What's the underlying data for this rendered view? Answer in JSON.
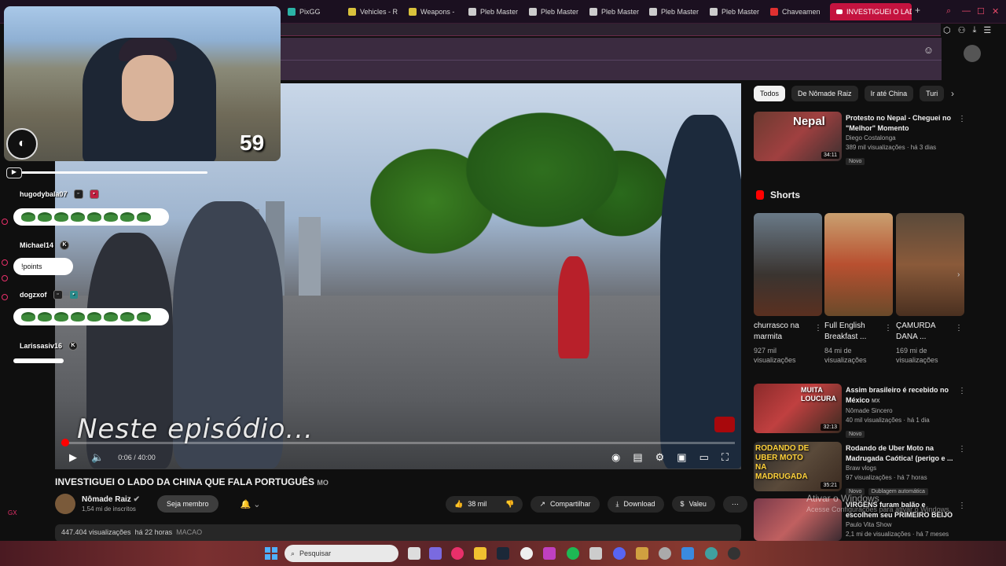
{
  "browser": {
    "tabs": [
      {
        "label": "PixGG",
        "color": "#2bb3a6"
      },
      {
        "label": "Vehicles - R",
        "color": "#d9c23c"
      },
      {
        "label": "Weapons -",
        "color": "#d9c23c"
      },
      {
        "label": "Pleb Master",
        "color": "#cccccc"
      },
      {
        "label": "Pleb Master",
        "color": "#cccccc"
      },
      {
        "label": "Pleb Master",
        "color": "#cccccc"
      },
      {
        "label": "Pleb Master",
        "color": "#cccccc"
      },
      {
        "label": "Pleb Master",
        "color": "#cccccc"
      },
      {
        "label": "Chaveamen",
        "color": "#e03030"
      }
    ],
    "active_tab": "INVESTIGUEI O LADO",
    "new_tab": "+"
  },
  "video": {
    "subtitle": "Neste episódio...",
    "current_time": "0:06 / 40:00",
    "progress": 0.0025
  },
  "watch": {
    "title": "INVESTIGUEI O LADO DA CHINA QUE FALA PORTUGUÊS",
    "title_suffix": "MO",
    "channel": "Nômade Raiz",
    "subscribers": "1,54 mi de inscritos",
    "member_button": "Seja membro",
    "likes": "38 mil",
    "share": "Compartilhar",
    "download": "Download",
    "thanks": "Valeu",
    "views": "447.404 visualizações",
    "ago": "há 22 horas",
    "location": "MACAO"
  },
  "sidebar": {
    "chips": [
      "Todos",
      "De Nômade Raiz",
      "Ir até China",
      "Turi"
    ],
    "recs": [
      {
        "title": "Protesto no Nepal - Cheguei no \"Melhor\" Momento",
        "channel": "Diego Costalonga",
        "meta": "389 mil visualizações · há 3 dias",
        "badge": "Novo",
        "duration": "34:11"
      },
      {
        "title": "Assim brasileiro é recebido no México",
        "title_suffix": "MX",
        "channel": "Nômade Sincero",
        "meta": "40 mil visualizações · há 1 dia",
        "badge": "Novo",
        "duration": "32:13"
      },
      {
        "title": "Rodando de Uber Moto na Madrugada Caótica! (perigo e ...",
        "channel": "Braw vlogs",
        "meta": "97 visualizações · há 7 horas",
        "badge": "Novo",
        "badge2": "Dublagem automática",
        "duration": "35:21"
      },
      {
        "title": "VIRGENS furam balão e escolhem seu PRIMEIRO BEIJO",
        "channel": "Paulo Vita Show",
        "meta": "2,1 mi de visualizações · há 7 meses",
        "badge": "",
        "duration": ""
      }
    ],
    "shorts_title": "Shorts",
    "shorts": [
      {
        "title": "churrasco na marmita",
        "views": "927 mil visualizações"
      },
      {
        "title": "Full English Breakfast ...",
        "views": "84 mi de visualizações"
      },
      {
        "title": "ÇAMURDA DANA ...",
        "views": "169 mi de visualizações"
      }
    ],
    "thumb_captions": [
      "Nepal",
      "MUITA LOUCURA",
      "RODANDO DE UBER MOTO NA MADRUGADA"
    ]
  },
  "overlay": {
    "cam_number": "59",
    "chat": [
      {
        "user": "hugodybala07",
        "message": ""
      },
      {
        "user": "Michael14",
        "message": "!points"
      },
      {
        "user": "dogzxof",
        "message": ""
      },
      {
        "user": "Larissasiv16",
        "message": ""
      }
    ],
    "side_label": "GX"
  },
  "os": {
    "watermark_title": "Ativar o Windows",
    "watermark_sub": "Acesse Configurações para ativar o Windows.",
    "search_placeholder": "Pesquisar"
  }
}
